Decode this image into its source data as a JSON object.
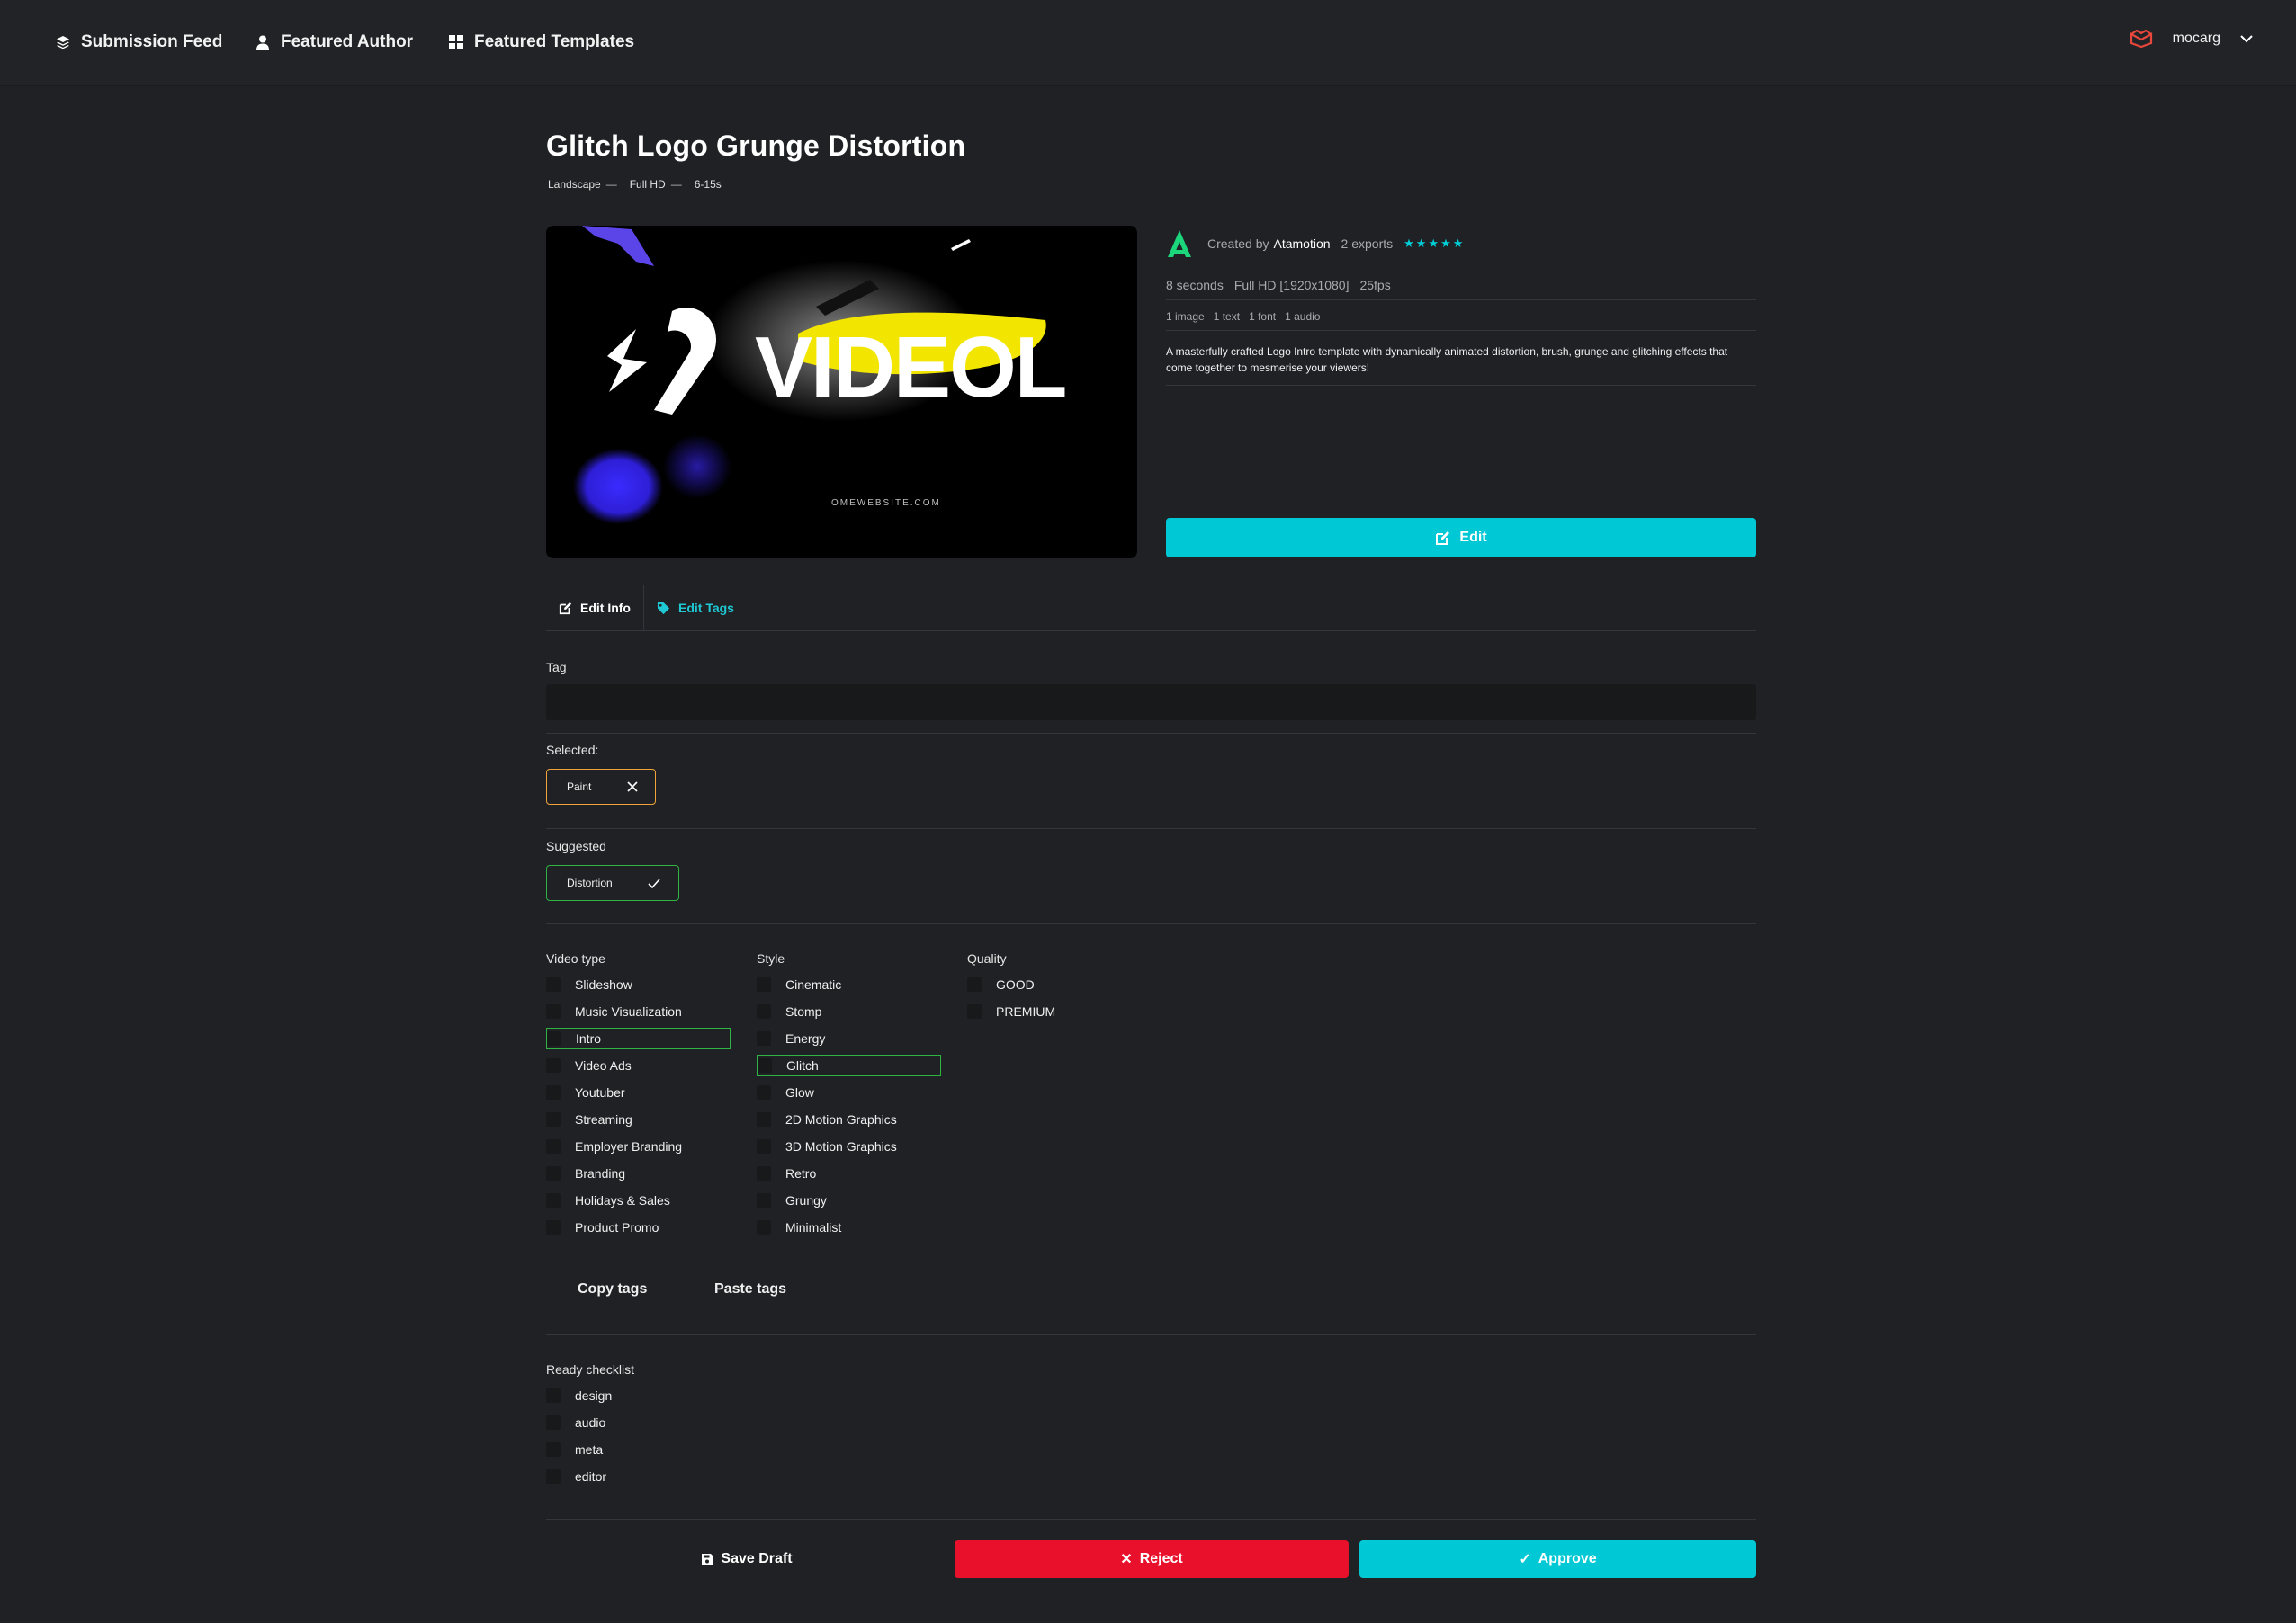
{
  "nav": {
    "items": [
      {
        "label": "Submission Feed",
        "icon": "layers-icon"
      },
      {
        "label": "Featured Author",
        "icon": "user-icon"
      },
      {
        "label": "Featured Templates",
        "icon": "grid-icon"
      }
    ],
    "username": "mocarg"
  },
  "template": {
    "title": "Glitch Logo Grunge Distortion",
    "orientation": "Landscape",
    "resolution": "Full HD",
    "duration_range": "6-15s",
    "preview_caption": "OMEWEBSITE.COM"
  },
  "info": {
    "created_by_label": "Created by",
    "author": "Atamotion",
    "exports": "2 exports",
    "stars": "★★★★★",
    "seconds": "8 seconds",
    "full_hd": "Full HD [1920x1080]",
    "fps": "25fps",
    "image_count": "1 image",
    "text_count": "1 text",
    "font_count": "1 font",
    "audio_count": "1 audio",
    "description": "A masterfully crafted Logo Intro template with dynamically animated distortion, brush, grunge and glitching effects that come together to mesmerise your viewers!",
    "edit_label": "Edit"
  },
  "tabs": {
    "edit_info": "Edit Info",
    "edit_tags": "Edit Tags"
  },
  "tags": {
    "tag_label": "Tag",
    "tag_value": "",
    "selected_label": "Selected:",
    "selected": [
      "Paint"
    ],
    "suggested_label": "Suggested",
    "suggested": [
      "Distortion"
    ]
  },
  "categories": {
    "video_type": {
      "title": "Video type",
      "items": [
        "Slideshow",
        "Music Visualization",
        "Intro",
        "Video Ads",
        "Youtuber",
        "Streaming",
        "Employer Branding",
        "Branding",
        "Holidays & Sales",
        "Product Promo"
      ],
      "selected": "Intro"
    },
    "style": {
      "title": "Style",
      "items": [
        "Cinematic",
        "Stomp",
        "Energy",
        "Glitch",
        "Glow",
        "2D Motion Graphics",
        "3D Motion Graphics",
        "Retro",
        "Grungy",
        "Minimalist"
      ],
      "selected": "Glitch"
    },
    "quality": {
      "title": "Quality",
      "items": [
        "GOOD",
        "PREMIUM"
      ]
    }
  },
  "tag_actions": {
    "copy": "Copy tags",
    "paste": "Paste tags"
  },
  "checklist": {
    "title": "Ready checklist",
    "items": [
      "design",
      "audio",
      "meta",
      "editor"
    ]
  },
  "actions": {
    "save_draft": "Save Draft",
    "reject": "Reject",
    "approve": "Approve"
  },
  "colors": {
    "accent": "#00c8d4",
    "reject": "#e8102a",
    "selected_chip": "#f0a33a",
    "suggested_chip": "#2fb343",
    "background": "#202125"
  }
}
